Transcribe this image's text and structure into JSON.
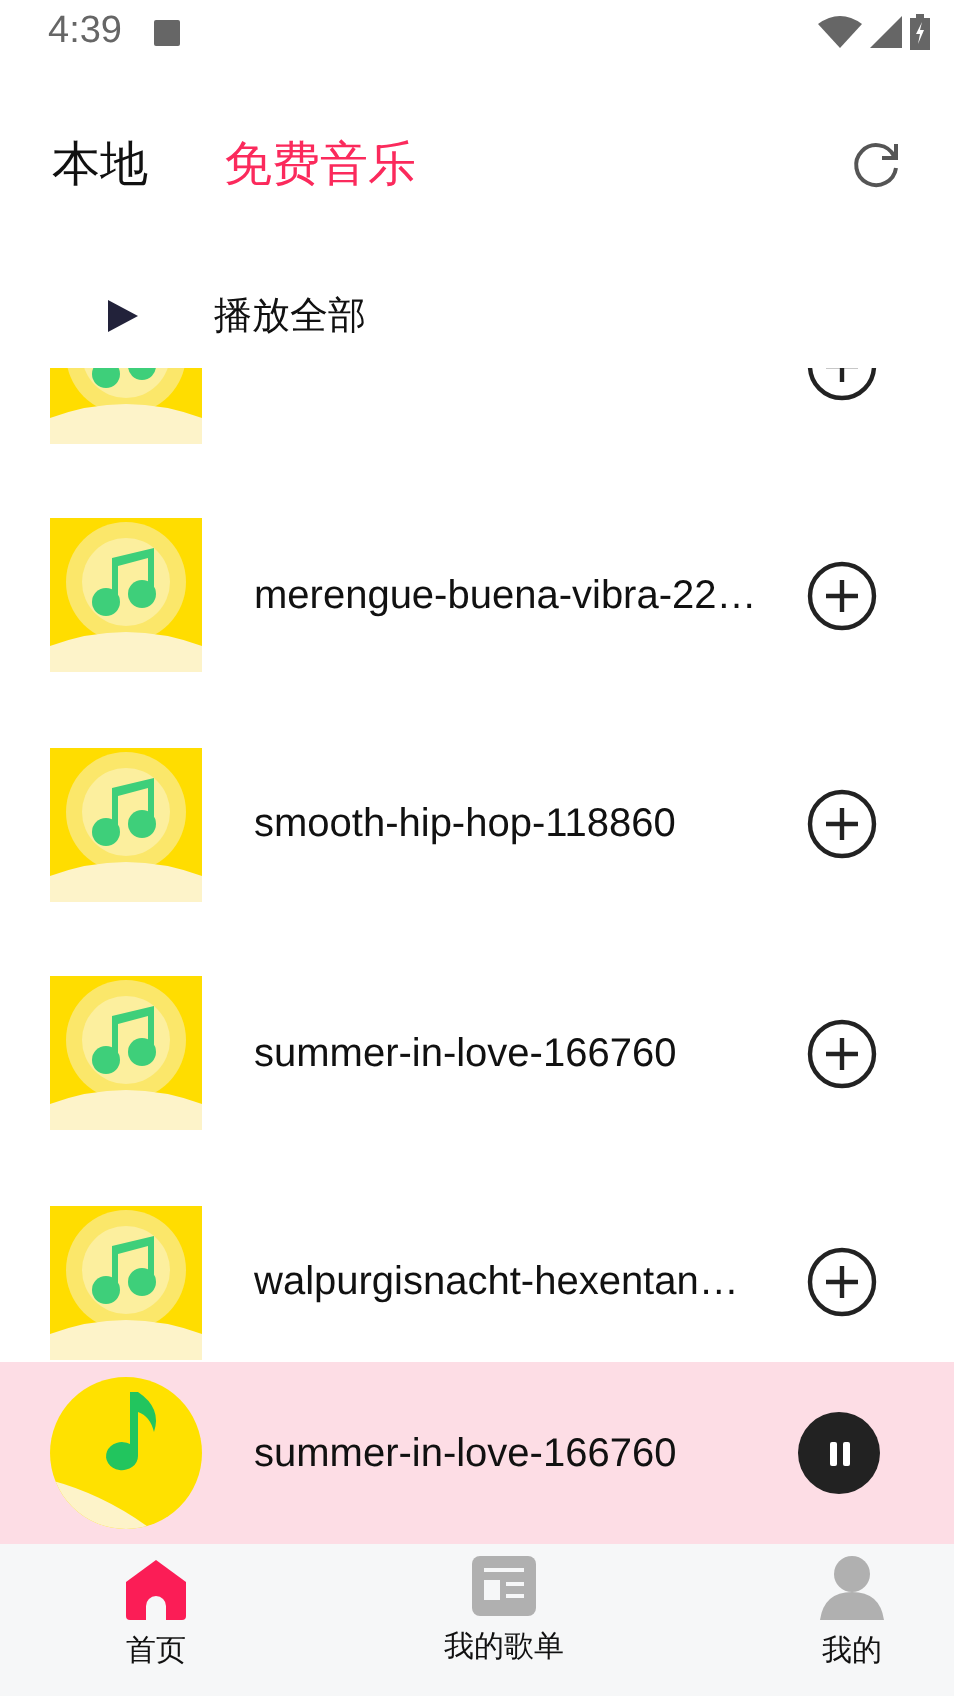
{
  "status_bar": {
    "time": "4:39"
  },
  "header": {
    "tabs": [
      {
        "label": "本地",
        "selected": false
      },
      {
        "label": "免费音乐",
        "selected": true
      }
    ]
  },
  "play_all": {
    "label": "播放全部"
  },
  "songs": [
    {
      "cover": {
        "kind": "picture"
      }
    },
    {
      "title": "merengue-buena-vibra-22…",
      "cover": {
        "kind": "picture"
      }
    },
    {
      "title": "smooth-hip-hop-118860",
      "cover": {
        "kind": "picture"
      }
    },
    {
      "title": "summer-in-love-166760",
      "cover": {
        "kind": "picture"
      }
    },
    {
      "title": "walpurgisnacht-hexentan…",
      "cover": {
        "kind": "picture"
      }
    }
  ],
  "now_playing": {
    "title": "summer-in-love-166760",
    "playing": true,
    "cover": {
      "kind": "picture"
    }
  },
  "bottom_nav": [
    {
      "label": "首页",
      "kind": "home",
      "selected": true
    },
    {
      "label": "我的歌单",
      "kind": "playlist",
      "selected": false
    },
    {
      "label": "我的",
      "kind": "person",
      "selected": false
    }
  ]
}
